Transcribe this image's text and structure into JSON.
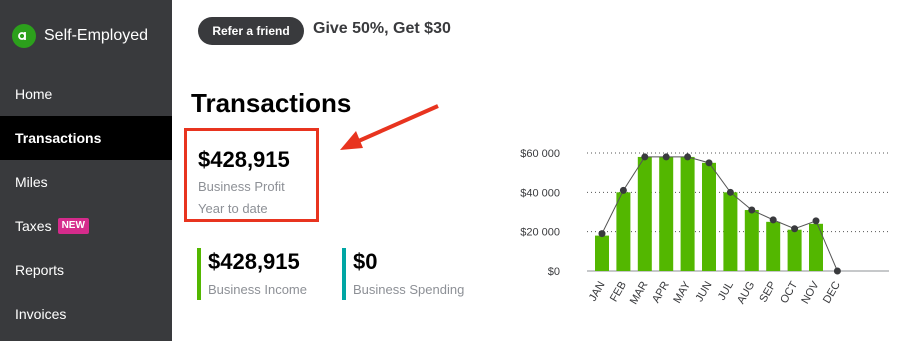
{
  "app": {
    "name": "Self-Employed",
    "logo_text": "qb"
  },
  "sidebar": {
    "items": [
      {
        "label": "Home",
        "active": false
      },
      {
        "label": "Transactions",
        "active": true
      },
      {
        "label": "Miles",
        "active": false
      },
      {
        "label": "Taxes",
        "active": false,
        "badge": "NEW"
      },
      {
        "label": "Reports",
        "active": false
      },
      {
        "label": "Invoices",
        "active": false
      }
    ]
  },
  "header": {
    "refer_label": "Refer a friend",
    "promo_text": "Give 50%, Get $30"
  },
  "main": {
    "title": "Transactions",
    "profit": {
      "value": "$428,915",
      "label": "Business Profit",
      "sublabel": "Year to date"
    },
    "income": {
      "value": "$428,915",
      "label": "Business Income"
    },
    "spending": {
      "value": "$0",
      "label": "Business Spending"
    }
  },
  "colors": {
    "sidebar": "#393a3d",
    "bar": "#53b700",
    "highlight": "#e8341f",
    "spending": "#00a6a4",
    "badge": "#d52b8c"
  },
  "chart_data": {
    "type": "bar",
    "categories": [
      "JAN",
      "FEB",
      "MAR",
      "APR",
      "MAY",
      "JUN",
      "JUL",
      "AUG",
      "SEP",
      "OCT",
      "NOV",
      "DEC"
    ],
    "series": [
      {
        "values": [
          18000,
          40000,
          58000,
          58000,
          58000,
          55000,
          40000,
          31000,
          25000,
          21000,
          24000,
          0
        ]
      }
    ],
    "line_overlay": [
      19000,
      41000,
      58000,
      58000,
      58000,
      55000,
      40000,
      31000,
      26000,
      21500,
      25500,
      0
    ],
    "yticks": [
      0,
      20000,
      40000,
      60000
    ],
    "ytick_labels": [
      "$0",
      "$20 000",
      "$40 000",
      "$60 000"
    ],
    "ylim": [
      0,
      60000
    ],
    "grid": true
  }
}
